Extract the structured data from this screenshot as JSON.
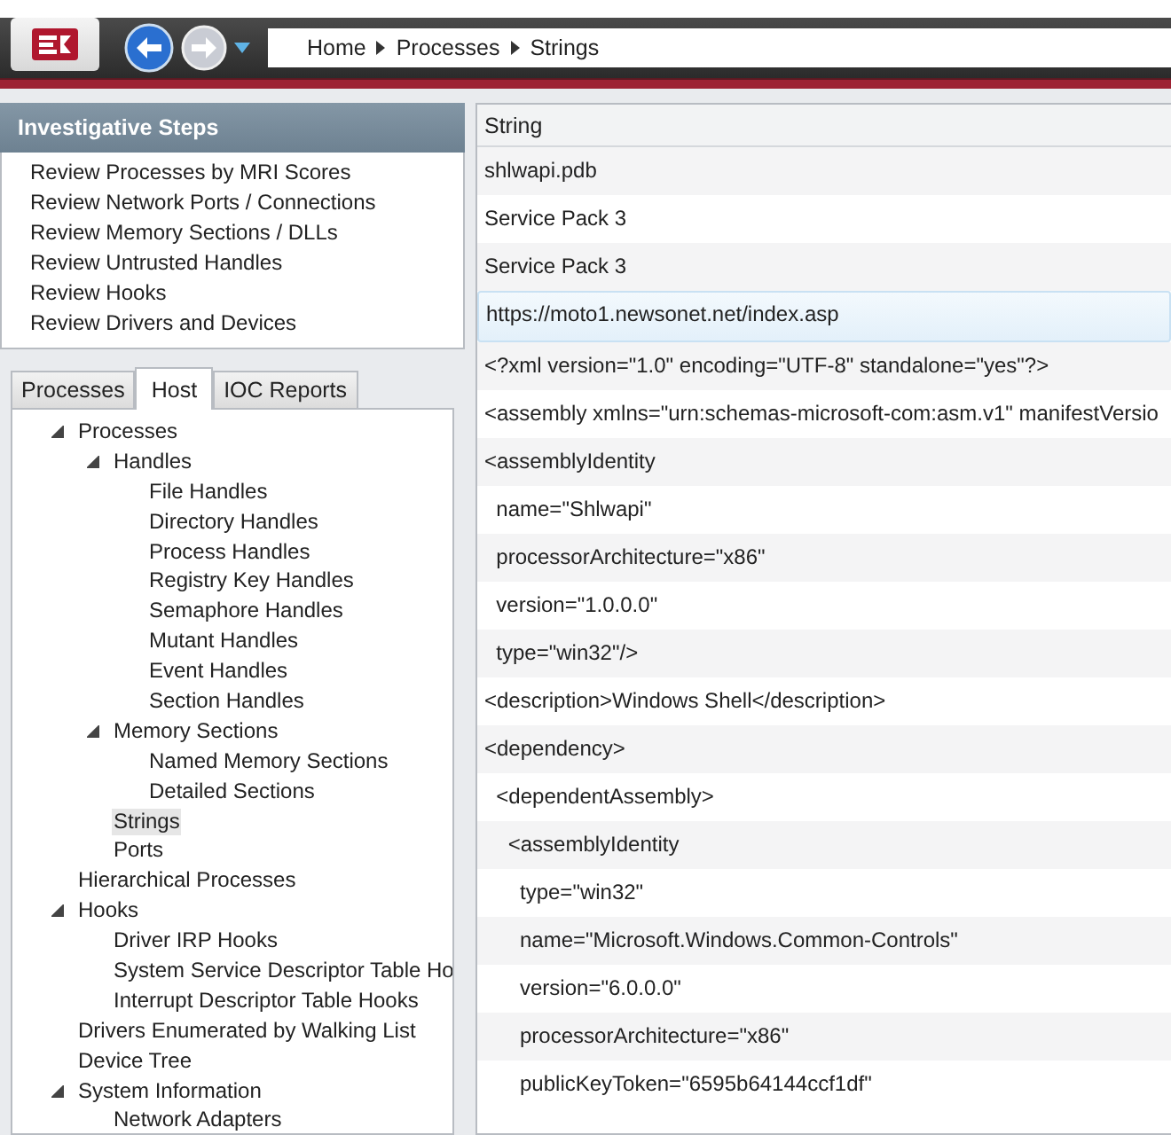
{
  "toolbar": {
    "breadcrumbs": [
      "Home",
      "Processes",
      "Strings"
    ]
  },
  "investigative_steps": {
    "title": "Investigative Steps",
    "items": [
      "Review Processes by MRI Scores",
      "Review Network Ports / Connections",
      "Review Memory Sections / DLLs",
      "Review Untrusted Handles",
      "Review Hooks",
      "Review Drivers and Devices"
    ]
  },
  "tabs": [
    {
      "label": "Processes",
      "selected": false
    },
    {
      "label": "Host",
      "selected": true
    },
    {
      "label": "IOC Reports",
      "selected": false
    }
  ],
  "tree": [
    {
      "label": "Processes",
      "expanded": true,
      "selected": false,
      "children": [
        {
          "label": "Handles",
          "expanded": true,
          "selected": false,
          "children": [
            {
              "label": "File Handles",
              "selected": false
            },
            {
              "label": "Directory Handles",
              "selected": false
            },
            {
              "label": "Process Handles",
              "selected": false
            },
            {
              "label": "Registry Key Handles",
              "selected": false
            },
            {
              "label": "Semaphore Handles",
              "selected": false
            },
            {
              "label": "Mutant Handles",
              "selected": false
            },
            {
              "label": "Event Handles",
              "selected": false
            },
            {
              "label": "Section Handles",
              "selected": false
            }
          ]
        },
        {
          "label": "Memory Sections",
          "expanded": true,
          "selected": false,
          "children": [
            {
              "label": "Named Memory Sections",
              "selected": false
            },
            {
              "label": "Detailed Sections",
              "selected": false
            }
          ]
        },
        {
          "label": "Strings",
          "selected": true
        },
        {
          "label": "Ports",
          "selected": false
        }
      ]
    },
    {
      "label": "Hierarchical Processes",
      "selected": false
    },
    {
      "label": "Hooks",
      "expanded": true,
      "selected": false,
      "children": [
        {
          "label": "Driver IRP Hooks",
          "selected": false
        },
        {
          "label": "System Service Descriptor Table Ho",
          "selected": false
        },
        {
          "label": "Interrupt Descriptor Table Hooks",
          "selected": false
        }
      ]
    },
    {
      "label": "Drivers Enumerated by Walking List",
      "selected": false
    },
    {
      "label": "Device Tree",
      "selected": false
    },
    {
      "label": "System Information",
      "expanded": true,
      "selected": false,
      "children": [
        {
          "label": "Network Adapters",
          "selected": false
        }
      ]
    }
  ],
  "table": {
    "columns": [
      "String"
    ],
    "rows": [
      {
        "text": "shlwapi.pdb",
        "selected": false
      },
      {
        "text": "Service Pack 3",
        "selected": false
      },
      {
        "text": "Service Pack 3",
        "selected": false
      },
      {
        "text": "https://moto1.newsonet.net/index.asp",
        "selected": true
      },
      {
        "text": "<?xml version=\"1.0\" encoding=\"UTF-8\" standalone=\"yes\"?>",
        "selected": false
      },
      {
        "text": "<assembly xmlns=\"urn:schemas-microsoft-com:asm.v1\" manifestVersio",
        "selected": false
      },
      {
        "text": "<assemblyIdentity",
        "selected": false
      },
      {
        "text": "  name=\"Shlwapi\"",
        "selected": false
      },
      {
        "text": "  processorArchitecture=\"x86\"",
        "selected": false
      },
      {
        "text": "  version=\"1.0.0.0\"",
        "selected": false
      },
      {
        "text": "  type=\"win32\"/>",
        "selected": false
      },
      {
        "text": "<description>Windows Shell</description>",
        "selected": false
      },
      {
        "text": "<dependency>",
        "selected": false
      },
      {
        "text": "  <dependentAssembly>",
        "selected": false
      },
      {
        "text": "    <assemblyIdentity",
        "selected": false
      },
      {
        "text": "      type=\"win32\"",
        "selected": false
      },
      {
        "text": "      name=\"Microsoft.Windows.Common-Controls\"",
        "selected": false
      },
      {
        "text": "      version=\"6.0.0.0\"",
        "selected": false
      },
      {
        "text": "      processorArchitecture=\"x86\"",
        "selected": false
      },
      {
        "text": "      publicKeyToken=\"6595b64144ccf1df\"",
        "selected": false
      }
    ]
  }
}
